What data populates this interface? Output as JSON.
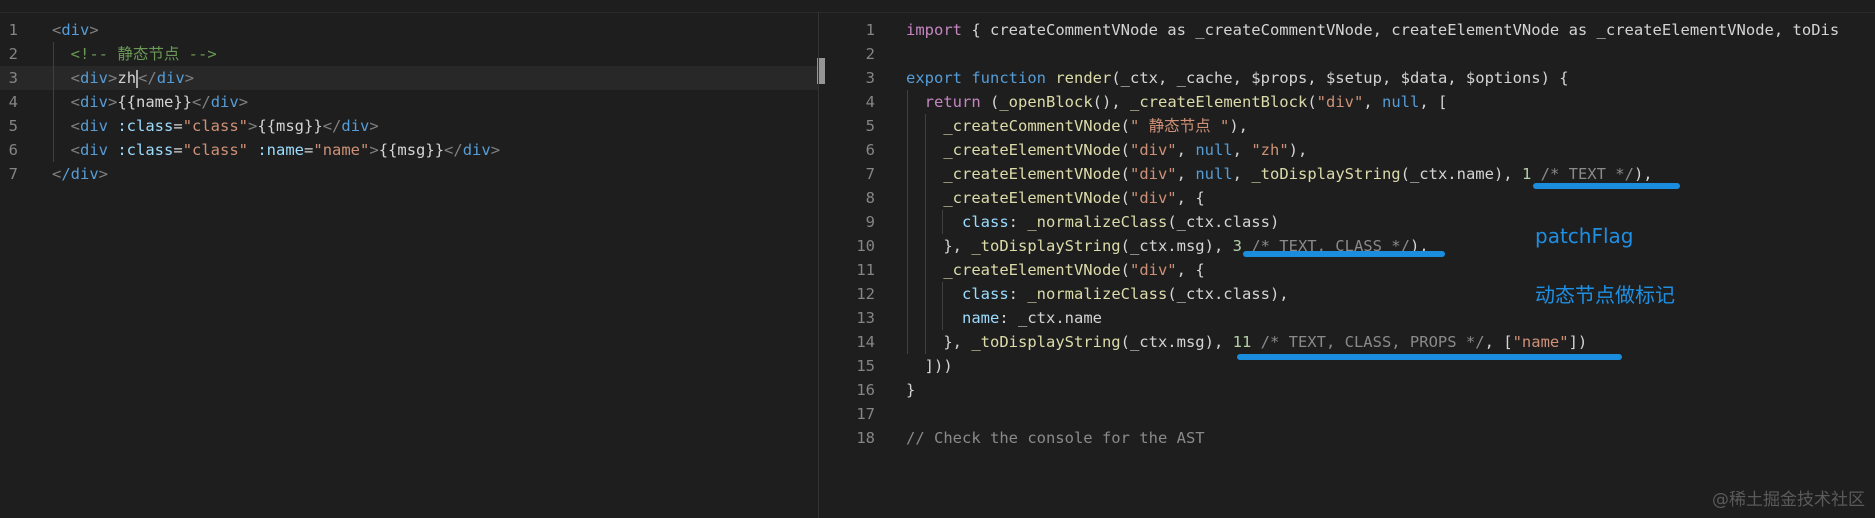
{
  "left_editor": {
    "lines": [
      {
        "n": "1",
        "code": [
          {
            "t": "<",
            "c": "br"
          },
          {
            "t": "div",
            "c": "tag"
          },
          {
            "t": ">",
            "c": "br"
          }
        ]
      },
      {
        "n": "2",
        "code": [
          {
            "t": "  ",
            "c": "txt"
          },
          {
            "t": "<!-- 静态节点 -->",
            "c": "cmt"
          }
        ]
      },
      {
        "n": "3",
        "code": [
          {
            "t": "  ",
            "c": "txt"
          },
          {
            "t": "<",
            "c": "br"
          },
          {
            "t": "div",
            "c": "tag"
          },
          {
            "t": ">",
            "c": "br"
          },
          {
            "t": "zh",
            "c": "txt"
          },
          {
            "t": "CURSOR",
            "c": "cursor"
          },
          {
            "t": "</",
            "c": "br"
          },
          {
            "t": "div",
            "c": "tag"
          },
          {
            "t": ">",
            "c": "br"
          }
        ]
      },
      {
        "n": "4",
        "code": [
          {
            "t": "  ",
            "c": "txt"
          },
          {
            "t": "<",
            "c": "br"
          },
          {
            "t": "div",
            "c": "tag"
          },
          {
            "t": ">",
            "c": "br"
          },
          {
            "t": "{{name}}",
            "c": "txt"
          },
          {
            "t": "</",
            "c": "br"
          },
          {
            "t": "div",
            "c": "tag"
          },
          {
            "t": ">",
            "c": "br"
          }
        ]
      },
      {
        "n": "5",
        "code": [
          {
            "t": "  ",
            "c": "txt"
          },
          {
            "t": "<",
            "c": "br"
          },
          {
            "t": "div",
            "c": "tag"
          },
          {
            "t": " :class",
            "c": "attr"
          },
          {
            "t": "=",
            "c": "txt"
          },
          {
            "t": "\"class\"",
            "c": "str"
          },
          {
            "t": ">",
            "c": "br"
          },
          {
            "t": "{{msg}}",
            "c": "txt"
          },
          {
            "t": "</",
            "c": "br"
          },
          {
            "t": "div",
            "c": "tag"
          },
          {
            "t": ">",
            "c": "br"
          }
        ]
      },
      {
        "n": "6",
        "code": [
          {
            "t": "  ",
            "c": "txt"
          },
          {
            "t": "<",
            "c": "br"
          },
          {
            "t": "div",
            "c": "tag"
          },
          {
            "t": " :class",
            "c": "attr"
          },
          {
            "t": "=",
            "c": "txt"
          },
          {
            "t": "\"class\"",
            "c": "str"
          },
          {
            "t": " :name",
            "c": "attr"
          },
          {
            "t": "=",
            "c": "txt"
          },
          {
            "t": "\"name\"",
            "c": "str"
          },
          {
            "t": ">",
            "c": "br"
          },
          {
            "t": "{{msg}}",
            "c": "txt"
          },
          {
            "t": "</",
            "c": "br"
          },
          {
            "t": "div",
            "c": "tag"
          },
          {
            "t": ">",
            "c": "br"
          }
        ]
      },
      {
        "n": "7",
        "code": [
          {
            "t": "<",
            "c": "br"
          },
          {
            "t": "/div",
            "c": "tag"
          },
          {
            "t": ">",
            "c": "br"
          }
        ]
      }
    ]
  },
  "right_editor": {
    "lines": [
      {
        "n": "1",
        "code": [
          {
            "t": "import",
            "c": "kw"
          },
          {
            "t": " { createCommentVNode as _createCommentVNode, createElementVNode as _createElementVNode, toDis",
            "c": "txt"
          }
        ]
      },
      {
        "n": "2",
        "code": []
      },
      {
        "n": "3",
        "code": [
          {
            "t": "export function",
            "c": "kw2"
          },
          {
            "t": " ",
            "c": "txt"
          },
          {
            "t": "render",
            "c": "fn"
          },
          {
            "t": "(_ctx, _cache, $props, $setup, $data, $options) {",
            "c": "txt"
          }
        ]
      },
      {
        "n": "4",
        "code": [
          {
            "t": "  ",
            "c": "txt"
          },
          {
            "t": "return",
            "c": "kw"
          },
          {
            "t": " (",
            "c": "txt"
          },
          {
            "t": "_openBlock",
            "c": "fn"
          },
          {
            "t": "(), ",
            "c": "txt"
          },
          {
            "t": "_createElementBlock",
            "c": "fn"
          },
          {
            "t": "(",
            "c": "txt"
          },
          {
            "t": "\"div\"",
            "c": "str"
          },
          {
            "t": ", ",
            "c": "txt"
          },
          {
            "t": "null",
            "c": "kw2"
          },
          {
            "t": ", [",
            "c": "txt"
          }
        ]
      },
      {
        "n": "5",
        "code": [
          {
            "t": "    ",
            "c": "txt"
          },
          {
            "t": "_createCommentVNode",
            "c": "fn"
          },
          {
            "t": "(",
            "c": "txt"
          },
          {
            "t": "\" 静态节点 \"",
            "c": "str"
          },
          {
            "t": "),",
            "c": "txt"
          }
        ]
      },
      {
        "n": "6",
        "code": [
          {
            "t": "    ",
            "c": "txt"
          },
          {
            "t": "_createElementVNode",
            "c": "fn"
          },
          {
            "t": "(",
            "c": "txt"
          },
          {
            "t": "\"div\"",
            "c": "str"
          },
          {
            "t": ", ",
            "c": "txt"
          },
          {
            "t": "null",
            "c": "kw2"
          },
          {
            "t": ", ",
            "c": "txt"
          },
          {
            "t": "\"zh\"",
            "c": "str"
          },
          {
            "t": "),",
            "c": "txt"
          }
        ]
      },
      {
        "n": "7",
        "code": [
          {
            "t": "    ",
            "c": "txt"
          },
          {
            "t": "_createElementVNode",
            "c": "fn"
          },
          {
            "t": "(",
            "c": "txt"
          },
          {
            "t": "\"div\"",
            "c": "str"
          },
          {
            "t": ", ",
            "c": "txt"
          },
          {
            "t": "null",
            "c": "kw2"
          },
          {
            "t": ", ",
            "c": "txt"
          },
          {
            "t": "_toDisplayString",
            "c": "fn"
          },
          {
            "t": "(_ctx.name), ",
            "c": "txt"
          },
          {
            "t": "1",
            "c": "num"
          },
          {
            "t": " /* TEXT */",
            "c": "gray"
          },
          {
            "t": "),",
            "c": "txt"
          }
        ]
      },
      {
        "n": "8",
        "code": [
          {
            "t": "    ",
            "c": "txt"
          },
          {
            "t": "_createElementVNode",
            "c": "fn"
          },
          {
            "t": "(",
            "c": "txt"
          },
          {
            "t": "\"div\"",
            "c": "str"
          },
          {
            "t": ", {",
            "c": "txt"
          }
        ]
      },
      {
        "n": "9",
        "code": [
          {
            "t": "      class",
            "c": "var"
          },
          {
            "t": ": ",
            "c": "txt"
          },
          {
            "t": "_normalizeClass",
            "c": "fn"
          },
          {
            "t": "(_ctx.class)",
            "c": "txt"
          }
        ]
      },
      {
        "n": "10",
        "code": [
          {
            "t": "    }, ",
            "c": "txt"
          },
          {
            "t": "_toDisplayString",
            "c": "fn"
          },
          {
            "t": "(_ctx.msg), ",
            "c": "txt"
          },
          {
            "t": "3",
            "c": "num"
          },
          {
            "t": " /* TEXT, CLASS */",
            "c": "gray"
          },
          {
            "t": "),",
            "c": "txt"
          }
        ]
      },
      {
        "n": "11",
        "code": [
          {
            "t": "    ",
            "c": "txt"
          },
          {
            "t": "_createElementVNode",
            "c": "fn"
          },
          {
            "t": "(",
            "c": "txt"
          },
          {
            "t": "\"div\"",
            "c": "str"
          },
          {
            "t": ", {",
            "c": "txt"
          }
        ]
      },
      {
        "n": "12",
        "code": [
          {
            "t": "      class",
            "c": "var"
          },
          {
            "t": ": ",
            "c": "txt"
          },
          {
            "t": "_normalizeClass",
            "c": "fn"
          },
          {
            "t": "(_ctx.class),",
            "c": "txt"
          }
        ]
      },
      {
        "n": "13",
        "code": [
          {
            "t": "      name",
            "c": "var"
          },
          {
            "t": ": _ctx.name",
            "c": "txt"
          }
        ]
      },
      {
        "n": "14",
        "code": [
          {
            "t": "    }, ",
            "c": "txt"
          },
          {
            "t": "_toDisplayString",
            "c": "fn"
          },
          {
            "t": "(_ctx.msg), ",
            "c": "txt"
          },
          {
            "t": "11",
            "c": "num"
          },
          {
            "t": " /* TEXT, CLASS, PROPS */",
            "c": "gray"
          },
          {
            "t": ", [",
            "c": "txt"
          },
          {
            "t": "\"name\"",
            "c": "str"
          },
          {
            "t": "])",
            "c": "txt"
          }
        ]
      },
      {
        "n": "15",
        "code": [
          {
            "t": "  ]))",
            "c": "txt"
          }
        ]
      },
      {
        "n": "16",
        "code": [
          {
            "t": "}",
            "c": "txt"
          }
        ]
      },
      {
        "n": "17",
        "code": []
      },
      {
        "n": "18",
        "code": [
          {
            "t": "// Check the console for the AST",
            "c": "gray"
          }
        ]
      }
    ]
  },
  "annotations": {
    "patch_flag": "patchFlag",
    "dynamic_mark": "动态节点做标记"
  },
  "watermark": "@稀土掘金技术社区",
  "colors": {
    "background": "#1e1e1e",
    "annotation": "#1a8ddf"
  }
}
